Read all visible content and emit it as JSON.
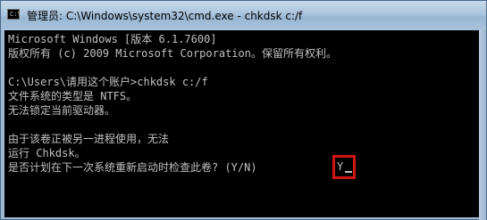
{
  "window": {
    "title": "管理员: C:\\Windows\\system32\\cmd.exe - chkdsk  c:/f",
    "icon": "cmd-icon",
    "icon_prompt": "C:\\"
  },
  "console": {
    "lines": [
      "Microsoft Windows [版本 6.1.7600]",
      "版权所有 (c) 2009 Microsoft Corporation。保留所有权利。",
      "",
      "C:\\Users\\请用这个账户>chkdsk c:/f",
      "文件系统的类型是 NTFS。",
      "无法锁定当前驱动器。",
      "",
      "由于该卷正被另一进程使用，无法",
      "运行 Chkdsk。",
      "是否计划在下一次系统重新启动时检查此卷? (Y/N)"
    ],
    "answer": "Y"
  },
  "colors": {
    "console_bg": "#000000",
    "console_text": "#c0c0c0",
    "highlight": "#d21414"
  }
}
